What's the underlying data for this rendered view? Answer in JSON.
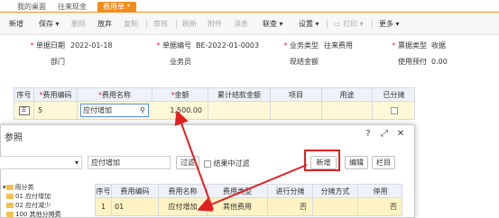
{
  "tabs": [
    {
      "label": "我的桌面"
    },
    {
      "label": "往来现金"
    },
    {
      "label": "费用单 *"
    }
  ],
  "toolbar": {
    "new": "新增",
    "save": "保存",
    "delete": "删除",
    "discard": "放弃",
    "copy": "复制",
    "audit": "审核",
    "refresh": "刷新",
    "attach": "附件",
    "message": "消息",
    "link": "联查",
    "settings": "设置",
    "print": "打印",
    "more": "更多"
  },
  "form": {
    "date_label": "单据日期",
    "date_value": "2022-01-18",
    "docno_label": "单据编号",
    "docno_value": "BE-2022-01-0003",
    "biztype_label": "业务类型",
    "biztype_value": "往来费用",
    "direction_label": "票据类型",
    "direction_value": "收据",
    "dept_label": "部门",
    "staff_label": "业务员",
    "cash_label": "现结金额",
    "prepay_label": "使用预付",
    "prepay_value": "0.00"
  },
  "grid": {
    "headers": [
      "序号",
      "费用编码",
      "费用名称",
      "金额",
      "累计结款金额",
      "项目",
      "用途",
      "已分摊"
    ],
    "row": {
      "seq": "5",
      "code": "",
      "name": "应付增加",
      "amount": "1,500.00"
    }
  },
  "dialog": {
    "title": "参照",
    "search_value": "应付增加",
    "filter_btn": "过滤",
    "in_result": "结果中过滤",
    "new_btn": "新增",
    "edit_btn": "编辑",
    "columns_btn": "栏目",
    "tree": [
      {
        "label": "用分类"
      },
      {
        "label": "01 应付增加"
      },
      {
        "label": "02 应付减少"
      },
      {
        "label": "100 其他分摊费"
      }
    ],
    "headers": [
      "序号",
      "费用编码",
      "费用名称",
      "费用类型",
      "进行分摊",
      "分摊方式",
      "停用"
    ],
    "row": {
      "seq": "1",
      "code": "01",
      "name": "应付增加",
      "type": "其他费用",
      "alloc": "否",
      "method": "",
      "disabled": "否"
    }
  },
  "colors": {
    "accent": "#f28c1c",
    "highlight_row": "#fff8d6",
    "annotation": "#e02020"
  }
}
